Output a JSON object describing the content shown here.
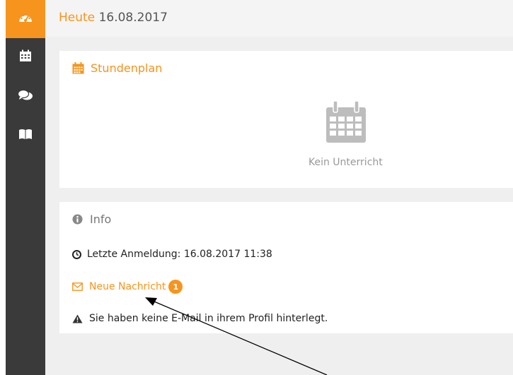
{
  "header": {
    "today_label": "Heute",
    "date": "16.08.2017"
  },
  "sidebar": {
    "items": [
      {
        "icon": "dashboard-icon",
        "active": true
      },
      {
        "icon": "calendar-icon",
        "active": false
      },
      {
        "icon": "chat-icon",
        "active": false
      },
      {
        "icon": "book-icon",
        "active": false
      }
    ]
  },
  "schedule": {
    "title": "Stundenplan",
    "empty_text": "Kein Unterricht"
  },
  "info": {
    "title": "Info",
    "last_login": "Letzte Anmeldung: 16.08.2017 11:38",
    "new_message_label": "Neue Nachricht",
    "new_message_count": "1",
    "no_email_warning": "Sie haben keine E-Mail in ihrem Profil hinterlegt."
  },
  "colors": {
    "accent": "#f7941d",
    "sidebar": "#3a3a3a",
    "background": "#efefef"
  }
}
